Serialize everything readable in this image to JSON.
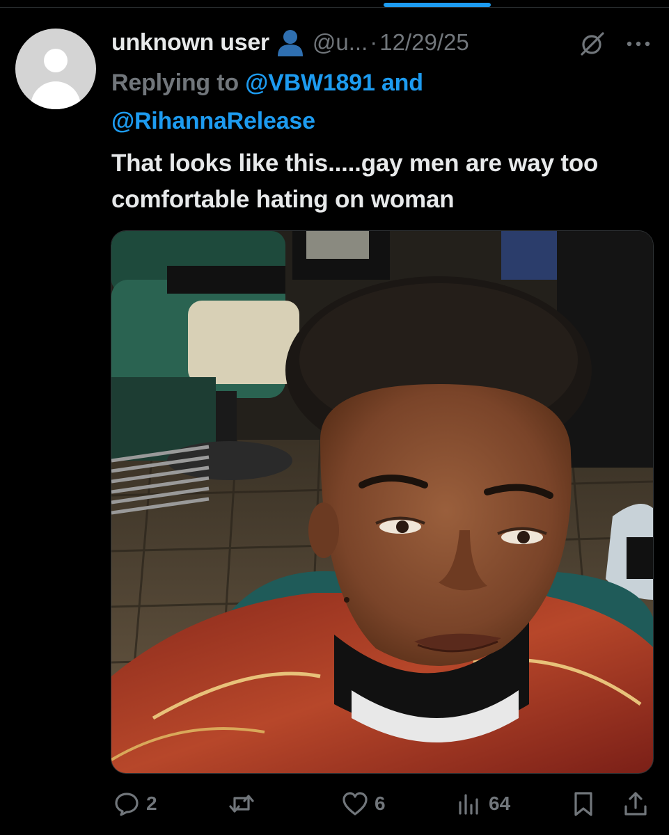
{
  "tweet": {
    "author": {
      "display_name": "unknown user",
      "handle": "@u...",
      "badge_icon": "person-silhouette-icon"
    },
    "separator": "·",
    "date": "12/29/25",
    "replying_prefix": "Replying to",
    "replying_to": [
      "@VBW1891",
      "@RihannaRelease"
    ],
    "replying_joiner": "and",
    "text": "That looks like this.....gay men are way too comfortable hating on woman",
    "media": {
      "type": "photo",
      "subject": "selfie-in-barbershop"
    }
  },
  "actions": {
    "reply": {
      "icon": "reply-bubble-icon",
      "count": "2"
    },
    "repost": {
      "icon": "repost-arrows-icon",
      "count": ""
    },
    "like": {
      "icon": "heart-icon",
      "count": "6"
    },
    "views": {
      "icon": "bar-chart-icon",
      "count": "64"
    },
    "bookmark": {
      "icon": "bookmark-icon"
    },
    "share": {
      "icon": "share-upload-icon"
    }
  },
  "colors": {
    "background": "#000000",
    "text_primary": "#e7e9ea",
    "text_secondary": "#71767b",
    "accent": "#1d9bf0"
  }
}
